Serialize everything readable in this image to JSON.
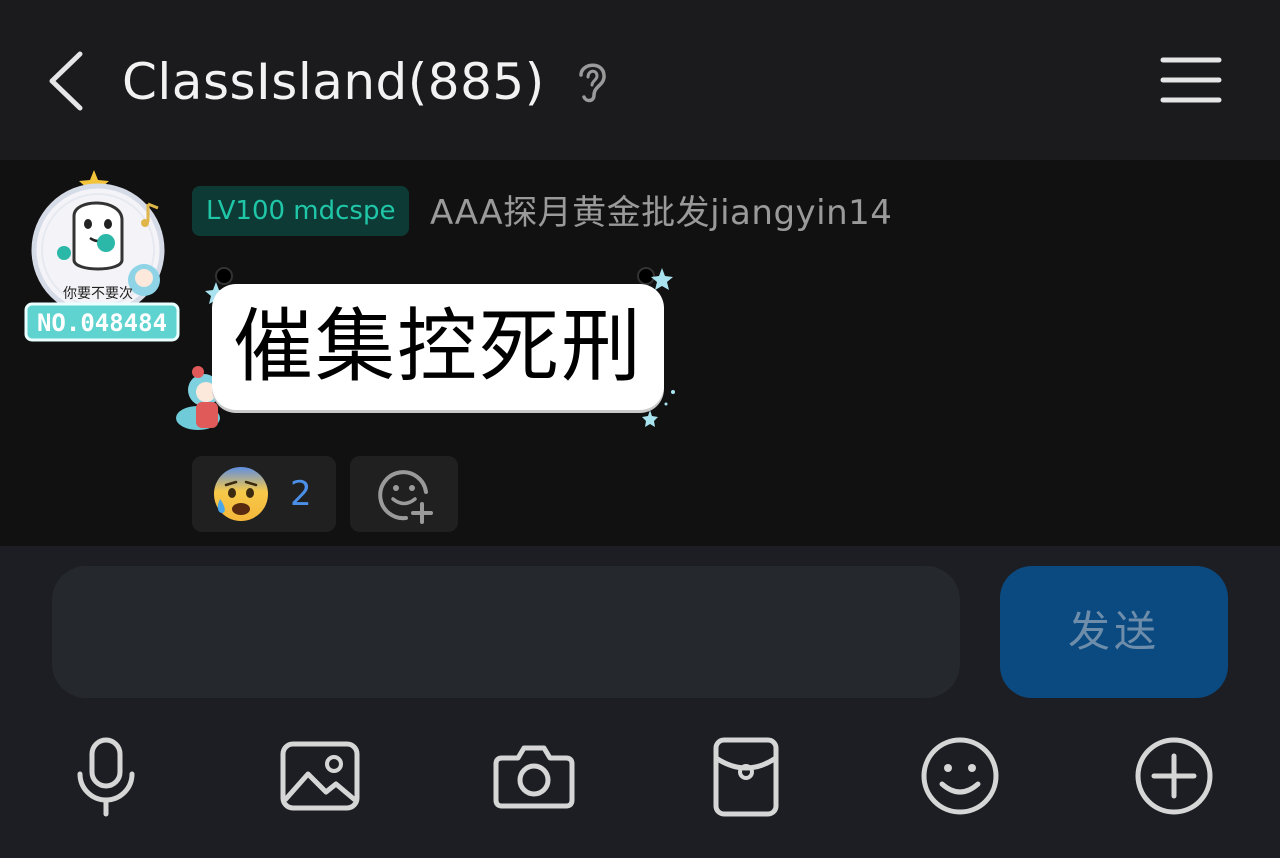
{
  "header": {
    "title": "ClassIsland(885)",
    "back_icon": "chevron-left-icon",
    "mode_icon": "ear-icon",
    "menu_icon": "hamburger-menu-icon"
  },
  "message": {
    "level_badge": "LV100 mdcspe",
    "sender": "AAA探月黄金批发jiangyin14",
    "avatar_plate": "NO.048484",
    "avatar_caption": "你要不要次",
    "text": "催集控死刑",
    "reactions": [
      {
        "emoji": "anxious-face-with-sweat-icon",
        "count": "2"
      }
    ],
    "add_reaction_icon": "add-reaction-icon"
  },
  "composer": {
    "input_value": "",
    "input_placeholder": "",
    "send_label": "发送",
    "tools": [
      "microphone-icon",
      "image-icon",
      "camera-icon",
      "red-packet-icon",
      "emoji-icon",
      "plus-icon"
    ]
  },
  "colors": {
    "header_bg": "#1b1b1d",
    "message_bg": "#111111",
    "composer_bg": "#1c1e23",
    "badge_text": "#20c6a8",
    "badge_bg": "#0e3a36",
    "count_blue": "#4b8fe8",
    "send_bg": "#0b4a80"
  }
}
